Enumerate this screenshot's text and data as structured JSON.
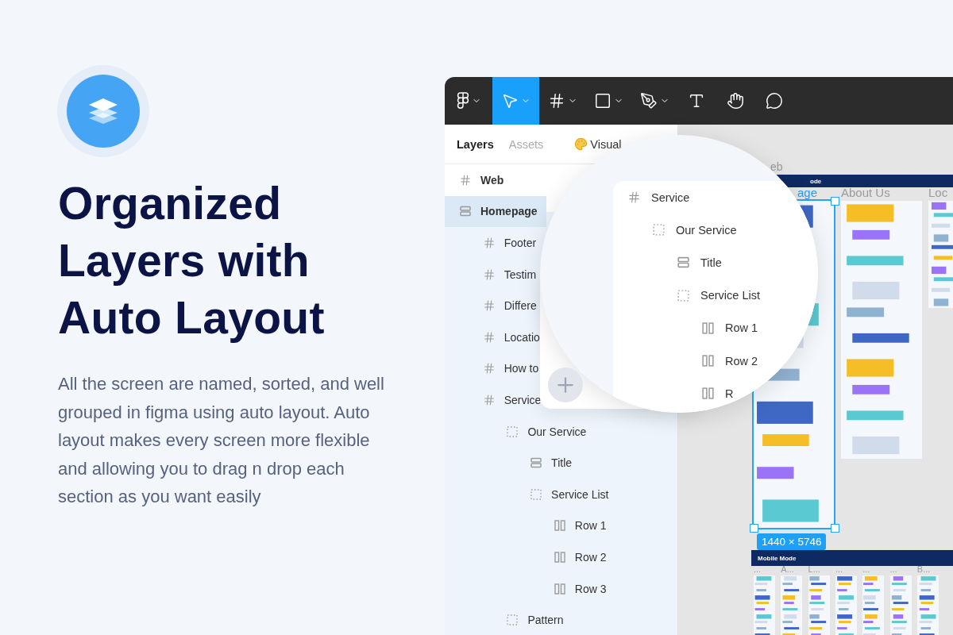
{
  "hero": {
    "heading": [
      "Organized",
      "Layers with",
      "Auto Layout"
    ],
    "description": "All the screen are named, sorted, and well grouped in figma using auto layout. Auto layout makes every screen more flexible and allowing you to drag n drop each section as you want easily"
  },
  "toolbar": {
    "tools": [
      {
        "kind": "logo",
        "selected": false,
        "menu": true
      },
      {
        "kind": "move",
        "selected": true,
        "menu": true
      },
      {
        "kind": "frame",
        "selected": false,
        "menu": true
      },
      {
        "kind": "shape",
        "selected": false,
        "menu": true
      },
      {
        "kind": "pen",
        "selected": false,
        "menu": true
      },
      {
        "kind": "text",
        "selected": false,
        "menu": false
      },
      {
        "kind": "hand",
        "selected": false,
        "menu": false
      },
      {
        "kind": "comment",
        "selected": false,
        "menu": false
      }
    ]
  },
  "panel_tabs": [
    {
      "label": "Layers",
      "selected": true,
      "kind": "plain"
    },
    {
      "label": "Assets",
      "selected": false,
      "kind": "plain"
    },
    {
      "label": "Visual",
      "selected": false,
      "kind": "page"
    }
  ],
  "layers": [
    {
      "name": "Web",
      "kind": "frame",
      "selected": false
    },
    {
      "name": "Homepage",
      "kind": "stack",
      "selected": true,
      "children": [
        {
          "name": "Footer",
          "kind": "frame",
          "selected": false
        },
        {
          "name": "Testim",
          "kind": "frame",
          "selected": false
        },
        {
          "name": "Differe",
          "kind": "frame",
          "selected": false
        },
        {
          "name": "Locatio",
          "kind": "frame",
          "selected": false
        },
        {
          "name": "How to",
          "kind": "frame",
          "selected": false
        },
        {
          "name": "Service",
          "kind": "frame",
          "selected": false,
          "children": [
            {
              "name": "Our Service",
              "kind": "group",
              "selected": false,
              "children": [
                {
                  "name": "Title",
                  "kind": "stack",
                  "selected": false
                },
                {
                  "name": "Service List",
                  "kind": "group",
                  "selected": false,
                  "children": [
                    {
                      "name": "Row 1",
                      "kind": "columns",
                      "selected": false
                    },
                    {
                      "name": "Row 2",
                      "kind": "columns",
                      "selected": false
                    },
                    {
                      "name": "Row 3",
                      "kind": "columns",
                      "selected": false
                    }
                  ]
                }
              ]
            },
            {
              "name": "Pattern",
              "kind": "group",
              "selected": false
            }
          ]
        }
      ]
    }
  ],
  "magnifier": {
    "layers": [
      {
        "name": "Service",
        "kind": "frame",
        "children": [
          {
            "name": "Our Service",
            "kind": "group",
            "children": [
              {
                "name": "Title",
                "kind": "stack"
              },
              {
                "name": "Service List",
                "kind": "group",
                "children": [
                  {
                    "name": "Row 1",
                    "kind": "columns"
                  },
                  {
                    "name": "Row 2",
                    "kind": "columns"
                  },
                  {
                    "name": "R",
                    "kind": "columns"
                  }
                ]
              }
            ]
          }
        ]
      }
    ]
  },
  "canvas": {
    "page_label": "eb",
    "web_section": "ode",
    "frames": [
      {
        "label": "age",
        "selected": true
      },
      {
        "label": "About Us",
        "selected": false
      },
      {
        "label": "Loc",
        "selected": false
      }
    ],
    "size_badge": "1440 × 5746",
    "mobile_section": "Mobile Mode",
    "mobile_frames": [
      "...",
      "A...",
      "L...",
      "...",
      "...",
      "...",
      "B..."
    ]
  }
}
